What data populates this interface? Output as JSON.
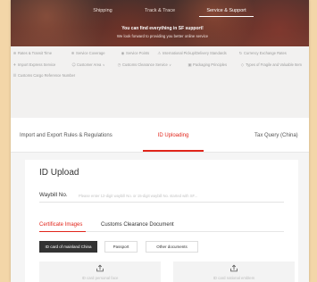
{
  "header": {
    "nav": [
      {
        "label": "Shipping"
      },
      {
        "label": "Track & Trace"
      },
      {
        "label": "Service & Support",
        "active": true
      }
    ],
    "headline": "You can find everything in SF support!",
    "subline": "We look forward to providing you better online service"
  },
  "quick_links": [
    {
      "label": "Rates & Transit Time",
      "icon": "rates-icon"
    },
    {
      "label": "Service Coverage",
      "icon": "coverage-icon"
    },
    {
      "label": "Service Points",
      "icon": "location-pin-icon"
    },
    {
      "label": "International Pickup/Delivery Standards",
      "icon": "warning-icon"
    },
    {
      "label": "Currency Exchange Rates",
      "icon": "exchange-icon"
    },
    {
      "label": "Import Express Service",
      "icon": "plane-icon"
    },
    {
      "label": "Customer Area",
      "icon": "user-icon",
      "dropdown": true
    },
    {
      "label": "Customs Clearance Service",
      "icon": "clock-icon",
      "dropdown": true
    },
    {
      "label": "Packaging Principles",
      "icon": "package-icon"
    },
    {
      "label": "Types of Fragile and Valuable Item",
      "icon": "diamond-icon"
    },
    {
      "label": "Customs Cargo Reference Number",
      "icon": "document-icon"
    }
  ],
  "section_tabs": [
    {
      "label": "Import and Export Rules & Regulations"
    },
    {
      "label": "ID Uploading",
      "active": true
    },
    {
      "label": "Tax Query (China)"
    }
  ],
  "id_upload": {
    "title": "ID Upload",
    "waybill_label": "Waybill No.",
    "waybill_placeholder": "Please enter 12-digit waybill No. or 15-digit waybill No. started with SF...",
    "document_tabs": [
      {
        "label": "Certificate Images",
        "active": true
      },
      {
        "label": "Customs Clearance Document"
      }
    ],
    "id_types": [
      {
        "label": "ID card of mainland China",
        "selected": true
      },
      {
        "label": "Passport"
      },
      {
        "label": "Other documents"
      }
    ],
    "upload_slots": [
      {
        "label": "ID card personal face",
        "icon": "upload-icon"
      },
      {
        "label": "ID card national emblem",
        "icon": "upload-icon"
      }
    ]
  },
  "colors": {
    "accent": "#e1251b",
    "page_border": "#f3d6a8",
    "selected_button": "#333333",
    "header_text": "#ffffff"
  }
}
